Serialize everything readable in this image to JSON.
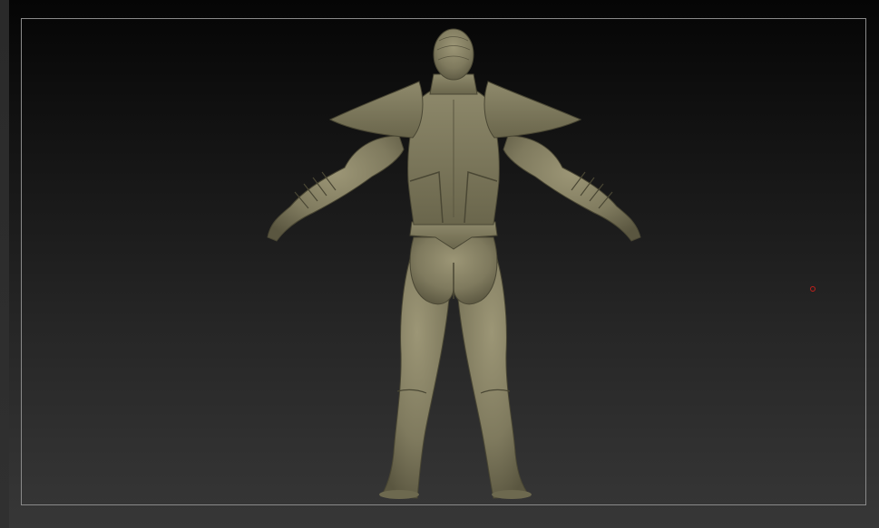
{
  "app": {
    "viewport": {
      "model": {
        "subject": "armored-character-back-view",
        "color": "#8a8466"
      },
      "frame_color": "#8a8a8a",
      "cursor_color": "#c0201b",
      "background_top": "#050505",
      "background_bottom": "#373737"
    }
  }
}
